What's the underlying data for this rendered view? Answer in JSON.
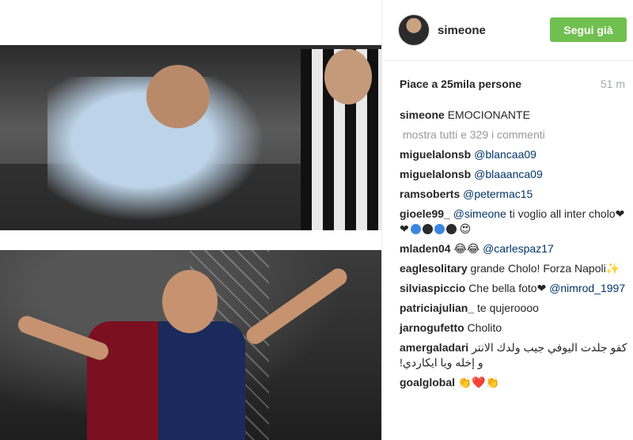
{
  "post": {
    "username": "simeone",
    "follow_label": "Segui già",
    "likes": "Piace a 25mila persone",
    "time": "51 m",
    "caption_user": "simeone",
    "caption_text": "EMOCIONANTE",
    "show_all": "mostra tutti e 329 i commenti"
  },
  "comments": [
    {
      "user": "miguelalonsb",
      "mention": "@blancaa09",
      "text": ""
    },
    {
      "user": "miguelalonsb",
      "mention": "@blaaanca09",
      "text": ""
    },
    {
      "user": "ramsoberts",
      "mention": "@petermac15",
      "text": ""
    },
    {
      "user": "gioele99_",
      "mention": "@simeone",
      "text": "ti voglio all inter cholo❤❤",
      "emoji_tail": "😍"
    },
    {
      "user": "mladen04",
      "mention": "@carlespaz17",
      "text": "😂😂"
    },
    {
      "user": "eaglesolitary",
      "mention": "",
      "text": "grande Cholo! Forza Napoli✨"
    },
    {
      "user": "silviaspiccio",
      "mention": "@nimrod_1997",
      "text": "Che bella foto❤"
    },
    {
      "user": "patriciajulian_",
      "mention": "",
      "text": "te qujeroooo"
    },
    {
      "user": "jarnogufetto",
      "mention": "",
      "text": "Cholito"
    },
    {
      "user": "amergaladari",
      "mention": "",
      "text": "كفو جلدت اليوفي جيب ولدك الانتر و إخله ويا ايكاردي!"
    },
    {
      "user": "goalglobal",
      "mention": "",
      "text": "👏❤️👏"
    }
  ],
  "colors": {
    "follow_bg": "#70c050",
    "mention": "#003569",
    "muted": "#a5a7aa"
  }
}
